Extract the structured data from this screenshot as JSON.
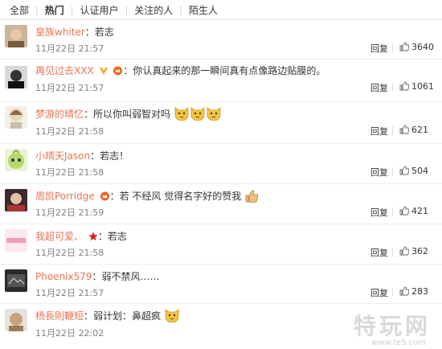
{
  "tabs": [
    {
      "label": "全部",
      "active": false
    },
    {
      "label": "热门",
      "active": true
    },
    {
      "label": "认证用户",
      "active": false
    },
    {
      "label": "关注的人",
      "active": false
    },
    {
      "label": "陌生人",
      "active": false
    }
  ],
  "comments": [
    {
      "user": "皇族whiter",
      "text": "若志",
      "time": "11月22日 21:57",
      "reply": "回复",
      "likes": "3640",
      "badges": []
    },
    {
      "user": "再见过去XXX",
      "text": "你认真起来的那一瞬间真有点像路边贴膜的。",
      "time": "11月22日 21:57",
      "reply": "回复",
      "likes": "1061",
      "badges": [
        "v-badge-icon",
        "crown-icon"
      ]
    },
    {
      "user": "梦游的晴忆",
      "text": "所以你叫弱智对吗",
      "time": "11月22日 21:58",
      "reply": "回复",
      "likes": "621",
      "badges": [],
      "emoji": 3
    },
    {
      "user": "小晴天Jason",
      "text": "若志！",
      "time": "11月22日 21:58",
      "reply": "回复",
      "likes": "504",
      "badges": []
    },
    {
      "user": "周凯Porridge",
      "text": "若 不经风 觉得名字好的赞我",
      "time": "11月22日 21:59",
      "reply": "回复",
      "likes": "421",
      "badges": [
        "crown-icon"
      ],
      "thumb_emoji": true
    },
    {
      "user": "我超可爱、",
      "text": "若志",
      "time": "11月22日 21:58",
      "reply": "回复",
      "likes": "362",
      "badges": [
        "star-icon"
      ]
    },
    {
      "user": "Phoenix579",
      "text": "弱不禁风……",
      "time": "11月22日 21:57",
      "reply": "回复",
      "likes": "283",
      "badges": []
    },
    {
      "user": "杨長則鞭短",
      "text": "弱计划：鼻超疯",
      "time": "11月22日 22:02",
      "reply": "回复",
      "likes": "",
      "badges": [],
      "emoji": 1
    }
  ],
  "watermark": {
    "main": "特玩网",
    "sub": "www.te5.com"
  },
  "colors": {
    "username": "#eb7350",
    "time": "#808080",
    "divider": "#ececec"
  }
}
